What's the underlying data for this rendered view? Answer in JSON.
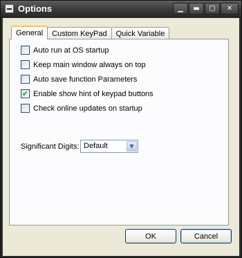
{
  "window": {
    "title": "Options"
  },
  "caption_buttons": {
    "restore_down": "▁",
    "minimize": "▬",
    "maximize": "▢",
    "close": "✕"
  },
  "tabs": [
    {
      "label": "General",
      "active": true
    },
    {
      "label": "Custom KeyPad",
      "active": false
    },
    {
      "label": "Quick Variable",
      "active": false
    }
  ],
  "options": [
    {
      "label": "Auto run at OS startup",
      "checked": false
    },
    {
      "label": "Keep main window always on top",
      "checked": false
    },
    {
      "label": "Auto save function Parameters",
      "checked": false
    },
    {
      "label": "Enable show hint of keypad buttons",
      "checked": true
    },
    {
      "label": "Check online updates on startup",
      "checked": false
    }
  ],
  "significant_digits": {
    "label": "Significant Digits:",
    "value": "Default"
  },
  "buttons": {
    "ok": "OK",
    "cancel": "Cancel"
  },
  "colors": {
    "titlebar": "#3a3a3a",
    "dialog": "#ece9d8",
    "active_tab_accent": "#ffc83c"
  }
}
